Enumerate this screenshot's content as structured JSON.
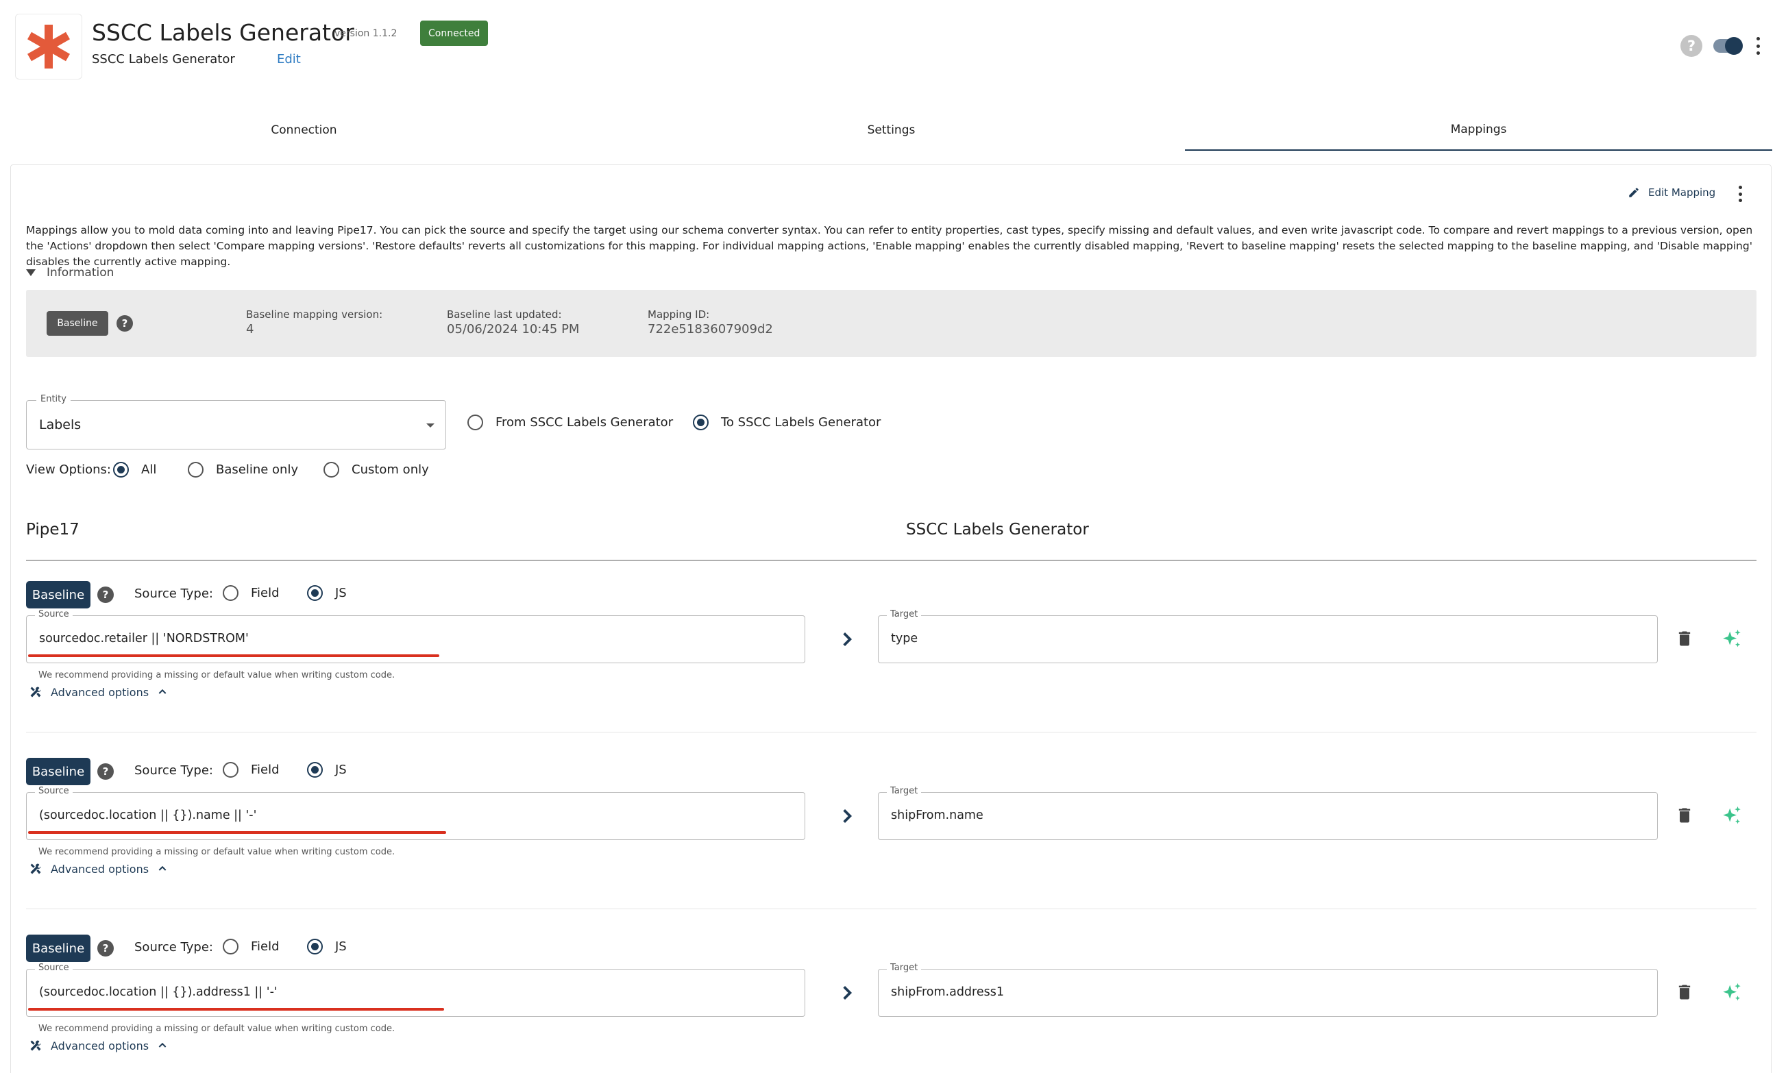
{
  "header": {
    "logo_icon": "asterisk-logo-icon",
    "title": "SSCC Labels Generator",
    "version": "version 1.1.2",
    "status": "Connected",
    "subtitle": "SSCC Labels Generator",
    "edit_label": "Edit",
    "help_glyph": "?",
    "toggle_on": true
  },
  "tabs": [
    {
      "label": "Connection",
      "active": false
    },
    {
      "label": "Settings",
      "active": false
    },
    {
      "label": "Mappings",
      "active": true
    }
  ],
  "panel": {
    "edit_mapping_label": "Edit Mapping",
    "description": "Mappings allow you to mold data coming into and leaving Pipe17. You can pick the source and specify the target using our schema converter syntax. You can refer to entity properties, cast types, specify missing and default values, and even write javascript code. To compare and revert mappings to a previous version, open the 'Actions' dropdown then select 'Compare mapping versions'. 'Restore defaults' reverts all customizations for this mapping. For individual mapping actions, 'Enable mapping' enables the currently disabled mapping, 'Revert to baseline mapping' resets the selected mapping to the baseline mapping, and 'Disable mapping' disables the currently active mapping.",
    "info_toggle_label": "Information",
    "info": {
      "badge": "Baseline",
      "version_label": "Baseline mapping version:",
      "version_value": "4",
      "updated_label": "Baseline last updated:",
      "updated_value": "05/06/2024 10:45 PM",
      "id_label": "Mapping ID:",
      "id_value": "722e5183607909d2"
    },
    "entity": {
      "label": "Entity",
      "value": "Labels"
    },
    "direction": {
      "from_label": "From SSCC Labels Generator",
      "to_label": "To SSCC Labels Generator",
      "selected": "to"
    },
    "view_options": {
      "label": "View Options:",
      "all": "All",
      "baseline_only": "Baseline only",
      "custom_only": "Custom only",
      "selected": "all"
    },
    "columns": {
      "left": "Pipe17",
      "right": "SSCC Labels Generator"
    }
  },
  "row_labels": {
    "badge": "Baseline",
    "source_type": "Source Type:",
    "field": "Field",
    "js": "JS",
    "source_label": "Source",
    "target_label": "Target",
    "hint": "We recommend providing a missing or default value when writing custom code.",
    "advanced": "Advanced options"
  },
  "mappings": [
    {
      "source": "sourcedoc.retailer || 'NORDSTROM'",
      "target": "type",
      "source_type": "JS"
    },
    {
      "source": "(sourcedoc.location || {}).name || '-'",
      "target": "shipFrom.name",
      "source_type": "JS"
    },
    {
      "source": "(sourcedoc.location || {}).address1 || '-'",
      "target": "shipFrom.address1",
      "source_type": "JS"
    }
  ],
  "colors": {
    "brand_logo": "#e35a3a",
    "primary": "#1e3a55",
    "status_green": "#3f7f3c",
    "error_red": "#d9301f",
    "ai_green": "#3cc48c",
    "link_blue": "#2f7cc2"
  }
}
